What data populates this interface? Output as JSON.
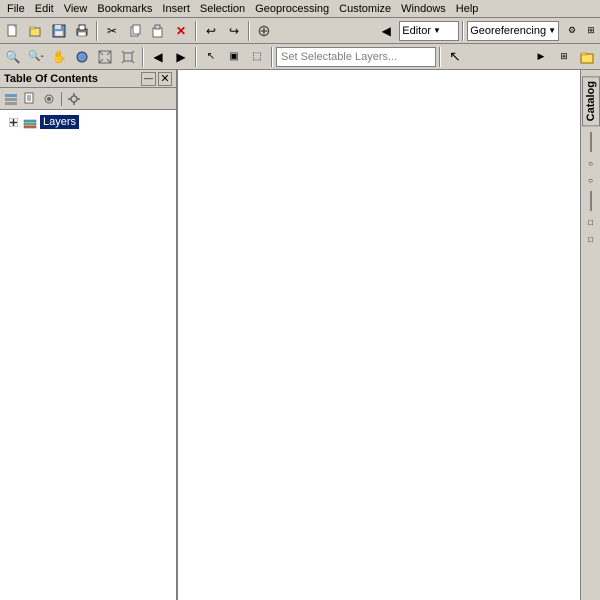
{
  "menubar": {
    "items": [
      "File",
      "Edit",
      "View",
      "Bookmarks",
      "Insert",
      "Selection",
      "Geoprocessing",
      "Customize",
      "Windows",
      "Help"
    ]
  },
  "toolbar1": {
    "buttons": [
      {
        "name": "new-button",
        "icon": "📄"
      },
      {
        "name": "open-button",
        "icon": "📂"
      },
      {
        "name": "save-button",
        "icon": "💾"
      },
      {
        "name": "print-button",
        "icon": "🖨"
      },
      {
        "name": "cut-button",
        "icon": "✂"
      },
      {
        "name": "copy-button",
        "icon": "📋"
      },
      {
        "name": "paste-button",
        "icon": "📎"
      },
      {
        "name": "delete-button",
        "icon": "✕"
      },
      {
        "name": "undo-button",
        "icon": "↩"
      },
      {
        "name": "redo-button",
        "icon": "↪"
      },
      {
        "name": "add-data-button",
        "icon": "+"
      }
    ],
    "editor_dropdown": "Editor",
    "georef_dropdown": "Georeferencing"
  },
  "toolbar2": {
    "selectable_layers_placeholder": "Set Selectable Layers..."
  },
  "toc": {
    "title": "Table Of Contents",
    "layers_label": "Layers"
  },
  "catalog": {
    "label": "Catalog"
  },
  "right_buttons": [
    "○",
    "○",
    "□",
    "□"
  ]
}
